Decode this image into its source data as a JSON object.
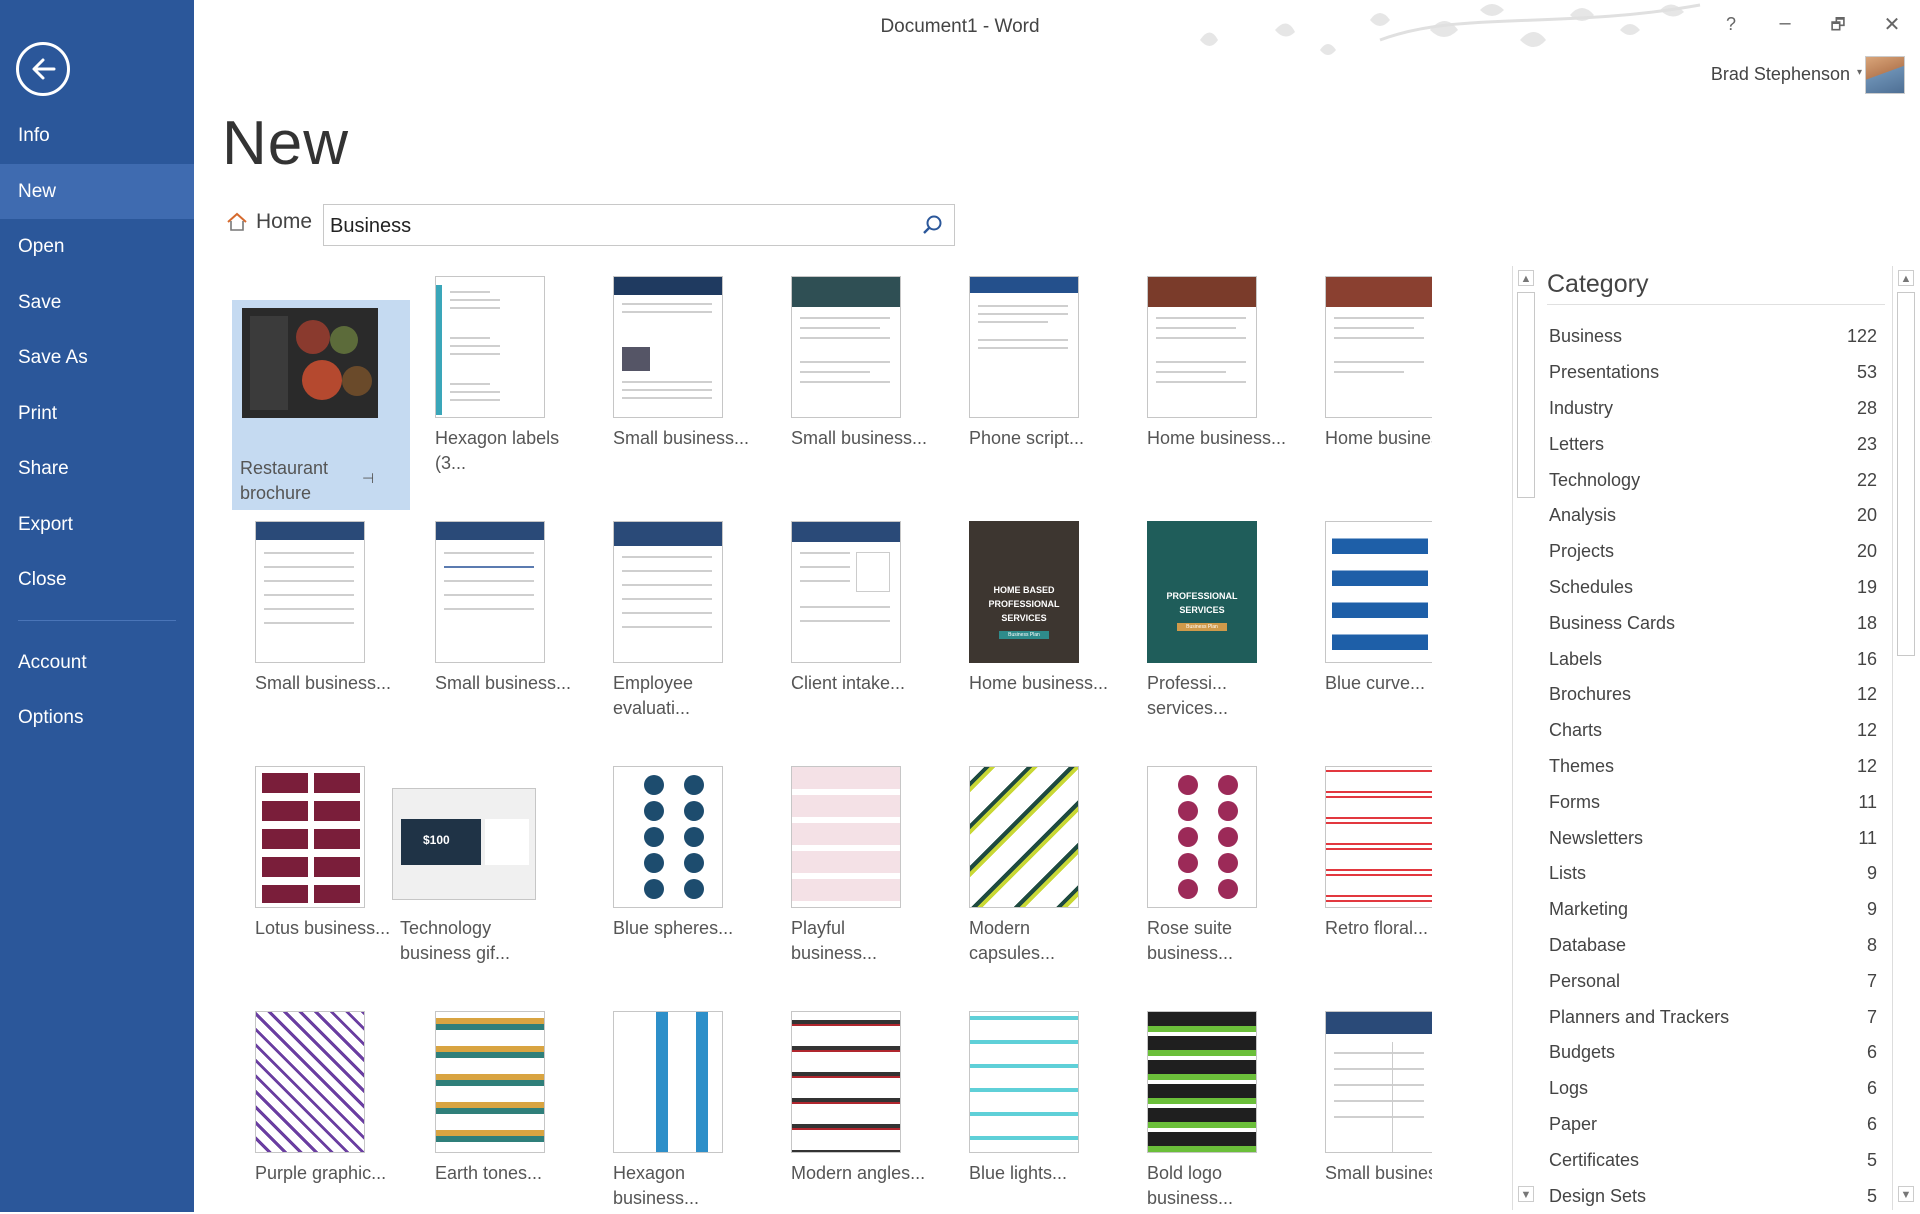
{
  "window": {
    "title": "Document1 - Word",
    "help_label": "?",
    "minimize_label": "–",
    "restore_label": "🗗",
    "close_label": "✕",
    "user_name": "Brad Stephenson"
  },
  "sidebar": {
    "items": [
      {
        "label": "Info"
      },
      {
        "label": "New"
      },
      {
        "label": "Open"
      },
      {
        "label": "Save"
      },
      {
        "label": "Save As"
      },
      {
        "label": "Print"
      },
      {
        "label": "Share"
      },
      {
        "label": "Export"
      },
      {
        "label": "Close"
      },
      {
        "label": "Account"
      },
      {
        "label": "Options"
      }
    ],
    "active": "New",
    "accent": "#2b579a"
  },
  "page": {
    "heading": "New",
    "home_label": "Home",
    "search_value": "Business"
  },
  "templates": [
    {
      "label": "Restaurant brochure",
      "selected": true
    },
    {
      "label": "Hexagon labels (3..."
    },
    {
      "label": "Small business..."
    },
    {
      "label": "Small business..."
    },
    {
      "label": "Phone script..."
    },
    {
      "label": "Home business..."
    },
    {
      "label": "Home business..."
    },
    {
      "label": "Small business..."
    },
    {
      "label": "Small business..."
    },
    {
      "label": "Employee evaluati..."
    },
    {
      "label": "Client intake..."
    },
    {
      "label": "Home business..."
    },
    {
      "label": "Professi... services..."
    },
    {
      "label": "Blue curve..."
    },
    {
      "label": "Lotus business..."
    },
    {
      "label": "Technology business gif..."
    },
    {
      "label": "Blue spheres..."
    },
    {
      "label": "Playful business..."
    },
    {
      "label": "Modern capsules..."
    },
    {
      "label": "Rose suite business..."
    },
    {
      "label": "Retro floral..."
    },
    {
      "label": "Purple graphic..."
    },
    {
      "label": "Earth tones..."
    },
    {
      "label": "Hexagon business..."
    },
    {
      "label": "Modern angles..."
    },
    {
      "label": "Blue lights..."
    },
    {
      "label": "Bold logo business..."
    },
    {
      "label": "Small business..."
    }
  ],
  "thumb_text": {
    "hb_professional": "HOME BASED PROFESSIONAL SERVICES",
    "hb_plan": "Business Plan",
    "prof_services": "PROFESSIONAL SERVICES",
    "prof_plan": "Business Plan",
    "gift_amount": "$100"
  },
  "category": {
    "title": "Category",
    "items": [
      {
        "name": "Business",
        "count": "122"
      },
      {
        "name": "Presentations",
        "count": "53"
      },
      {
        "name": "Industry",
        "count": "28"
      },
      {
        "name": "Letters",
        "count": "23"
      },
      {
        "name": "Technology",
        "count": "22"
      },
      {
        "name": "Analysis",
        "count": "20"
      },
      {
        "name": "Projects",
        "count": "20"
      },
      {
        "name": "Schedules",
        "count": "19"
      },
      {
        "name": "Business Cards",
        "count": "18"
      },
      {
        "name": "Labels",
        "count": "16"
      },
      {
        "name": "Brochures",
        "count": "12"
      },
      {
        "name": "Charts",
        "count": "12"
      },
      {
        "name": "Themes",
        "count": "12"
      },
      {
        "name": "Forms",
        "count": "11"
      },
      {
        "name": "Newsletters",
        "count": "11"
      },
      {
        "name": "Lists",
        "count": "9"
      },
      {
        "name": "Marketing",
        "count": "9"
      },
      {
        "name": "Database",
        "count": "8"
      },
      {
        "name": "Personal",
        "count": "7"
      },
      {
        "name": "Planners and Trackers",
        "count": "7"
      },
      {
        "name": "Budgets",
        "count": "6"
      },
      {
        "name": "Logs",
        "count": "6"
      },
      {
        "name": "Paper",
        "count": "6"
      },
      {
        "name": "Certificates",
        "count": "5"
      },
      {
        "name": "Design Sets",
        "count": "5"
      }
    ]
  },
  "icons": {
    "back": "back-arrow-icon",
    "home": "home-icon",
    "search": "search-icon",
    "pin": "pin-icon"
  }
}
